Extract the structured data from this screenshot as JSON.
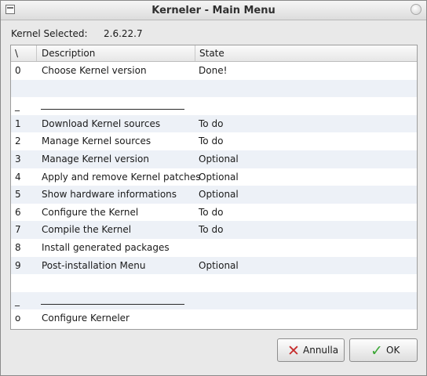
{
  "window": {
    "title": "Kerneler - Main Menu"
  },
  "kernel": {
    "label": "Kernel Selected:",
    "value": "2.6.22.7"
  },
  "table": {
    "columns": [
      "\\",
      "Description",
      "State"
    ],
    "rows": [
      {
        "num": "0",
        "description": "Choose Kernel version",
        "state": "Done!"
      },
      {
        "num": "",
        "description": "",
        "state": ""
      },
      {
        "num": "_",
        "description": "separator",
        "state": ""
      },
      {
        "num": "1",
        "description": "Download Kernel sources",
        "state": "To do"
      },
      {
        "num": "2",
        "description": "Manage Kernel sources",
        "state": "To do"
      },
      {
        "num": "3",
        "description": "Manage Kernel version",
        "state": "Optional"
      },
      {
        "num": "4",
        "description": "Apply and remove Kernel patches",
        "state": "Optional"
      },
      {
        "num": "5",
        "description": "Show hardware informations",
        "state": "Optional"
      },
      {
        "num": "6",
        "description": "Configure the Kernel",
        "state": "To do"
      },
      {
        "num": "7",
        "description": "Compile the Kernel",
        "state": "To do"
      },
      {
        "num": "8",
        "description": "Install generated packages",
        "state": ""
      },
      {
        "num": "9",
        "description": "Post-installation Menu",
        "state": "Optional"
      },
      {
        "num": "",
        "description": "",
        "state": ""
      },
      {
        "num": "_",
        "description": "separator",
        "state": ""
      },
      {
        "num": "o",
        "description": "Configure Kerneler",
        "state": ""
      }
    ]
  },
  "buttons": {
    "cancel_label": "Annulla",
    "cancel_icon": "cross-icon",
    "ok_label": "OK",
    "ok_icon": "checkmark-icon"
  },
  "colors": {
    "row_alt": "#edf1f7",
    "cancel_icon": "#c62c2c",
    "ok_icon": "#3aa634"
  }
}
